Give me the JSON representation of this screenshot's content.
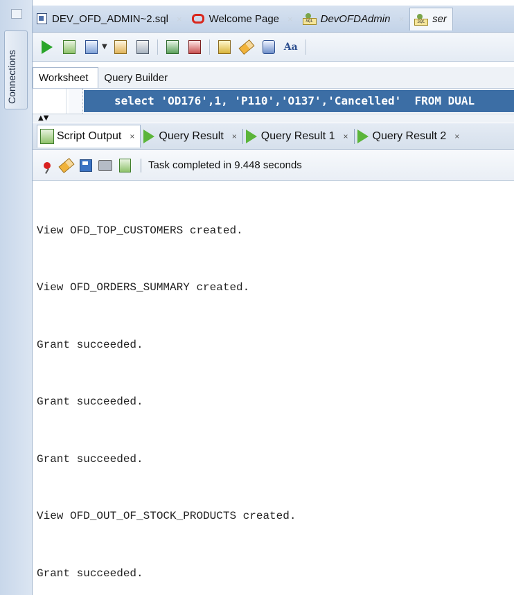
{
  "sidebar": {
    "connections_label": "Connections"
  },
  "editor_tabs": [
    {
      "label": "DEV_OFD_ADMIN~2.sql",
      "icon": "sql-file-icon",
      "italic": false
    },
    {
      "label": "Welcome Page",
      "icon": "oracle-icon",
      "italic": false
    },
    {
      "label": "DevOFDAdmin",
      "icon": "sql-connection-icon",
      "italic": true
    },
    {
      "label": "ser",
      "icon": "sql-connection-icon",
      "italic": true
    }
  ],
  "worksheet_tabs": {
    "worksheet": "Worksheet",
    "query_builder": "Query Builder"
  },
  "editor": {
    "selected_sql": "select 'OD176',1, 'P110','O137','Cancelled'  FROM DUAL"
  },
  "output_tabs": [
    {
      "label": "Script Output",
      "close": "×"
    },
    {
      "label": "Query Result",
      "close": "×"
    },
    {
      "label": "Query Result 1",
      "close": "×"
    },
    {
      "label": "Query Result 2",
      "close": "×"
    }
  ],
  "status": {
    "text": "Task completed in 9.448 seconds"
  },
  "output_lines": [
    "View OFD_TOP_CUSTOMERS created.",
    "View OFD_ORDERS_SUMMARY created.",
    "Grant succeeded.",
    "Grant succeeded.",
    "Grant succeeded.",
    "View OFD_OUT_OF_STOCK_PRODUCTS created.",
    "Grant succeeded."
  ],
  "colors": {
    "selection": "#3c6ea5",
    "run_green": "#2aa52a",
    "oracle_red": "#d9261c"
  }
}
